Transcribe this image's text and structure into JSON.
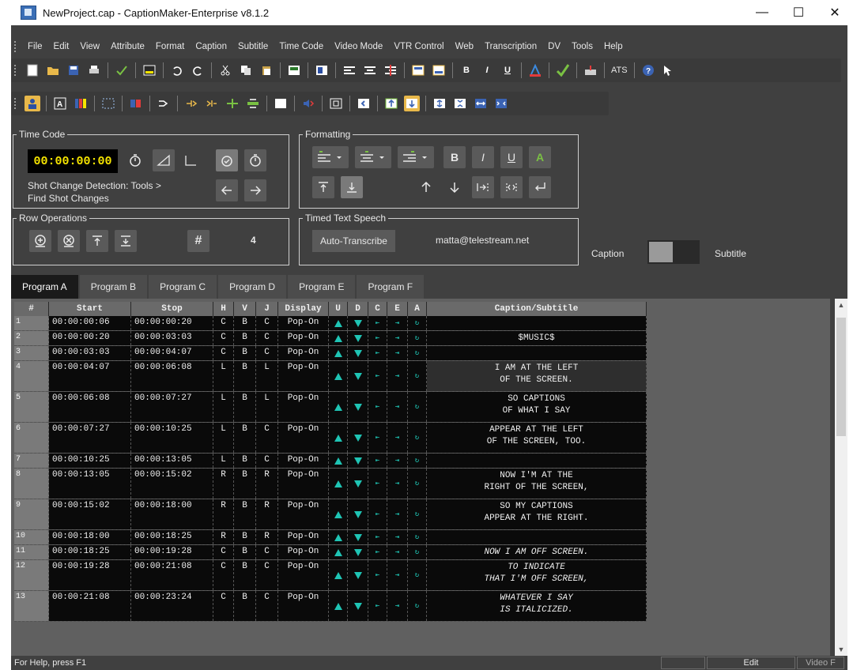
{
  "window": {
    "title": "NewProject.cap - CaptionMaker-Enterprise v8.1.2",
    "minimize": "—",
    "maximize": "☐",
    "close": "✕"
  },
  "menu": [
    "File",
    "Edit",
    "View",
    "Attribute",
    "Format",
    "Caption",
    "Subtitle",
    "Time Code",
    "Video Mode",
    "VTR Control",
    "Web",
    "Transcription",
    "DV",
    "Tools",
    "Help"
  ],
  "toolbar": {
    "bold": "B",
    "italic": "I",
    "underline": "U",
    "ats": "ATS"
  },
  "timecode": {
    "label": "Time Code",
    "value": "00:00:00:00",
    "hint_line1": "Shot Change Detection: Tools >",
    "hint_line2": "Find Shot Changes"
  },
  "formatting": {
    "label": "Formatting",
    "bold": "B",
    "italic": "I",
    "underline": "U",
    "color": "A"
  },
  "row_operations": {
    "label": "Row Operations",
    "hash": "#",
    "count": "4"
  },
  "timed_text": {
    "label": "Timed Text Speech",
    "auto_transcribe": "Auto-Transcribe",
    "email": "matta@telestream.net"
  },
  "mode_toggle": {
    "left_label": "Caption",
    "right_label": "Subtitle"
  },
  "tabs": [
    "Program A",
    "Program B",
    "Program C",
    "Program D",
    "Program E",
    "Program F"
  ],
  "grid": {
    "headers": [
      "#",
      "Start",
      "Stop",
      "H",
      "V",
      "J",
      "Display",
      "U",
      "D",
      "C",
      "E",
      "A",
      "Caption/Subtitle"
    ],
    "rows": [
      {
        "num": "1",
        "start": "00:00:00:06",
        "stop": "00:00:00:20",
        "h": "C",
        "v": "B",
        "j": "C",
        "display": "Pop-On",
        "caption": ""
      },
      {
        "num": "2",
        "start": "00:00:00:20",
        "stop": "00:00:03:03",
        "h": "C",
        "v": "B",
        "j": "C",
        "display": "Pop-On",
        "caption": "$MUSIC$"
      },
      {
        "num": "3",
        "start": "00:00:03:03",
        "stop": "00:00:04:07",
        "h": "C",
        "v": "B",
        "j": "C",
        "display": "Pop-On",
        "caption": ""
      },
      {
        "num": "4",
        "start": "00:00:04:07",
        "stop": "00:00:06:08",
        "h": "L",
        "v": "B",
        "j": "L",
        "display": "Pop-On",
        "caption": "I AM AT THE LEFT\nOF THE SCREEN.",
        "tall": true,
        "selected": true
      },
      {
        "num": "5",
        "start": "00:00:06:08",
        "stop": "00:00:07:27",
        "h": "L",
        "v": "B",
        "j": "L",
        "display": "Pop-On",
        "caption": "SO CAPTIONS\nOF WHAT I SAY",
        "tall": true
      },
      {
        "num": "6",
        "start": "00:00:07:27",
        "stop": "00:00:10:25",
        "h": "L",
        "v": "B",
        "j": "C",
        "display": "Pop-On",
        "caption": "APPEAR AT THE LEFT\nOF THE SCREEN, TOO.",
        "tall": true
      },
      {
        "num": "7",
        "start": "00:00:10:25",
        "stop": "00:00:13:05",
        "h": "L",
        "v": "B",
        "j": "C",
        "display": "Pop-On",
        "caption": ""
      },
      {
        "num": "8",
        "start": "00:00:13:05",
        "stop": "00:00:15:02",
        "h": "R",
        "v": "B",
        "j": "R",
        "display": "Pop-On",
        "caption": "NOW I'M AT THE\nRIGHT OF THE SCREEN,",
        "tall": true
      },
      {
        "num": "9",
        "start": "00:00:15:02",
        "stop": "00:00:18:00",
        "h": "R",
        "v": "B",
        "j": "R",
        "display": "Pop-On",
        "caption": "SO MY CAPTIONS\nAPPEAR AT THE RIGHT.",
        "tall": true
      },
      {
        "num": "10",
        "start": "00:00:18:00",
        "stop": "00:00:18:25",
        "h": "R",
        "v": "B",
        "j": "R",
        "display": "Pop-On",
        "caption": ""
      },
      {
        "num": "11",
        "start": "00:00:18:25",
        "stop": "00:00:19:28",
        "h": "C",
        "v": "B",
        "j": "C",
        "display": "Pop-On",
        "caption": "NOW I AM OFF SCREEN.",
        "italic": true
      },
      {
        "num": "12",
        "start": "00:00:19:28",
        "stop": "00:00:21:08",
        "h": "C",
        "v": "B",
        "j": "C",
        "display": "Pop-On",
        "caption": "TO INDICATE\nTHAT I'M OFF SCREEN,",
        "tall": true,
        "italic": true
      },
      {
        "num": "13",
        "start": "00:00:21:08",
        "stop": "00:00:23:24",
        "h": "C",
        "v": "B",
        "j": "C",
        "display": "Pop-On",
        "caption": "WHATEVER I SAY\nIS ITALICIZED.",
        "tall": true,
        "italic": true
      }
    ]
  },
  "status": {
    "help": "For Help, press F1",
    "mode": "Edit",
    "video": "Video F"
  },
  "colors": {
    "chrome": "#404040",
    "grid_bg": "#0a0a0a",
    "timecode_text": "#f5e400",
    "accent_teal": "#1fc4b4"
  }
}
